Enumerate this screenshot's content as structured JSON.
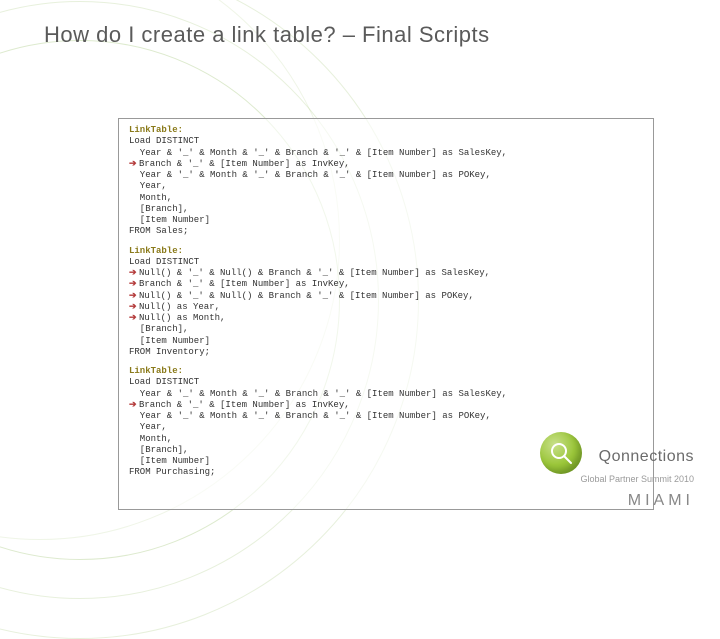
{
  "title": "How do I create a link table? – Final Scripts",
  "blocks": [
    {
      "label": "LinkTable:",
      "lines": [
        {
          "arrow": false,
          "text": "Load DISTINCT"
        },
        {
          "arrow": false,
          "text": "  Year & '_' & Month & '_' & Branch & '_' & [Item Number] as SalesKey,"
        },
        {
          "arrow": true,
          "text": "Branch & '_' & [Item Number] as InvKey,"
        },
        {
          "arrow": false,
          "text": "  Year & '_' & Month & '_' & Branch & '_' & [Item Number] as POKey,"
        },
        {
          "arrow": false,
          "text": "  Year,"
        },
        {
          "arrow": false,
          "text": "  Month,"
        },
        {
          "arrow": false,
          "text": "  [Branch],"
        },
        {
          "arrow": false,
          "text": "  [Item Number]"
        },
        {
          "arrow": false,
          "text": "FROM Sales;"
        }
      ]
    },
    {
      "label": "LinkTable:",
      "lines": [
        {
          "arrow": false,
          "text": "Load DISTINCT"
        },
        {
          "arrow": true,
          "text": "Null() & '_' & Null() & Branch & '_' & [Item Number] as SalesKey,"
        },
        {
          "arrow": true,
          "text": "Branch & '_' & [Item Number] as InvKey,"
        },
        {
          "arrow": true,
          "text": "Null() & '_' & Null() & Branch & '_' & [Item Number] as POKey,"
        },
        {
          "arrow": true,
          "text": "Null() as Year,"
        },
        {
          "arrow": true,
          "text": "Null() as Month,"
        },
        {
          "arrow": false,
          "text": "  [Branch],"
        },
        {
          "arrow": false,
          "text": "  [Item Number]"
        },
        {
          "arrow": false,
          "text": "FROM Inventory;"
        }
      ]
    },
    {
      "label": "LinkTable:",
      "lines": [
        {
          "arrow": false,
          "text": "Load DISTINCT"
        },
        {
          "arrow": false,
          "text": "  Year & '_' & Month & '_' & Branch & '_' & [Item Number] as SalesKey,"
        },
        {
          "arrow": true,
          "text": "Branch & '_' & [Item Number] as InvKey,"
        },
        {
          "arrow": false,
          "text": "  Year & '_' & Month & '_' & Branch & '_' & [Item Number] as POKey,"
        },
        {
          "arrow": false,
          "text": "  Year,"
        },
        {
          "arrow": false,
          "text": "  Month,"
        },
        {
          "arrow": false,
          "text": "  [Branch],"
        },
        {
          "arrow": false,
          "text": "  [Item Number]"
        },
        {
          "arrow": false,
          "text": "FROM Purchasing;"
        }
      ]
    }
  ],
  "brand": {
    "name": "Qonnections",
    "sub": "Global Partner Summit 2010",
    "city": "MIAMI"
  }
}
